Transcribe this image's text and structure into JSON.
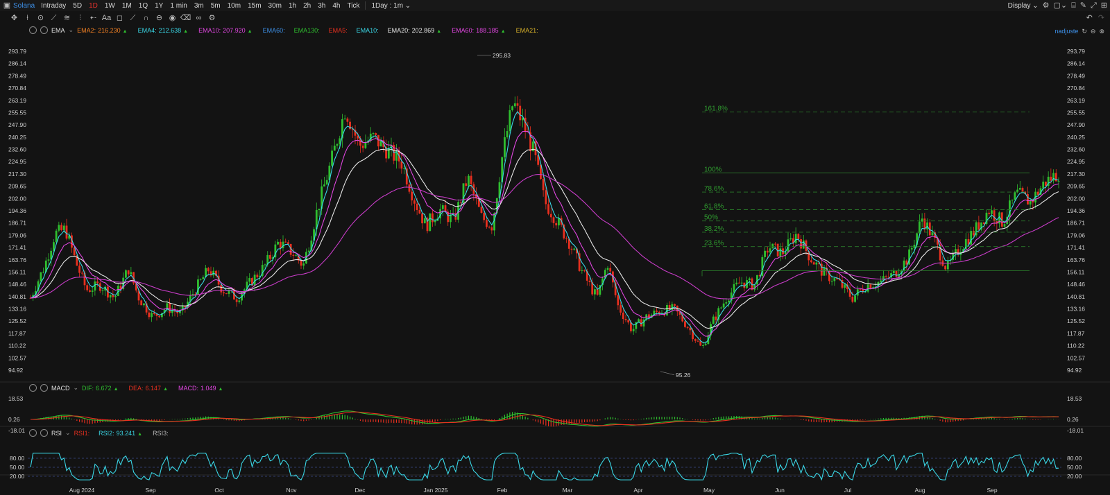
{
  "topbar": {
    "symbol": "Solana",
    "intervals": [
      "Intraday",
      "5D",
      "1D",
      "1W",
      "1M",
      "1Q",
      "1Y",
      "1 min",
      "3m",
      "5m",
      "10m",
      "15m",
      "30m",
      "1h",
      "2h",
      "3h",
      "4h",
      "Tick"
    ],
    "active_interval": "1D",
    "range_select": "1Day : 1m",
    "display_label": "Display",
    "adjust_label": "nadjuste"
  },
  "colors": {
    "up": "#2fbf2f",
    "down": "#e8301f",
    "accent": "#e6322d",
    "symbol": "#3d8fe6"
  },
  "main_legend": {
    "indicator": "EMA",
    "items": [
      {
        "label": "EMA2:",
        "value": "216.230",
        "color": "#f07f23",
        "arrow": "▲"
      },
      {
        "label": "EMA4:",
        "value": "212.638",
        "color": "#3ad7e6",
        "arrow": "▲"
      },
      {
        "label": "EMA10:",
        "value": "207.920",
        "color": "#e046e0",
        "arrow": "▲"
      },
      {
        "label": "EMA60:",
        "value": "",
        "color": "#3d8fe6",
        "arrow": ""
      },
      {
        "label": "EMA130:",
        "value": "",
        "color": "#2fbf2f",
        "arrow": ""
      },
      {
        "label": "EMA5:",
        "value": "",
        "color": "#e8301f",
        "arrow": ""
      },
      {
        "label": "EMA10:",
        "value": "",
        "color": "#3ad7e6",
        "arrow": ""
      },
      {
        "label": "EMA20:",
        "value": "202.869",
        "color": "#e6e6e6",
        "arrow": "▲"
      },
      {
        "label": "EMA60:",
        "value": "188.185",
        "color": "#e046e0",
        "arrow": "▲"
      },
      {
        "label": "EMA21:",
        "value": "",
        "color": "#d6b02a",
        "arrow": ""
      }
    ]
  },
  "macd_legend": {
    "indicator": "MACD",
    "items": [
      {
        "label": "DIF:",
        "value": "6.672",
        "color": "#2fbf2f",
        "arrow": "▲"
      },
      {
        "label": "DEA:",
        "value": "6.147",
        "color": "#e8301f",
        "arrow": "▲"
      },
      {
        "label": "MACD:",
        "value": "1.049",
        "color": "#e046e0",
        "arrow": "▲"
      }
    ]
  },
  "rsi_legend": {
    "indicator": "RSI",
    "items": [
      {
        "label": "RSI1:",
        "value": "",
        "color": "#e8301f",
        "arrow": ""
      },
      {
        "label": "RSI2:",
        "value": "93.241",
        "color": "#3ad7e6",
        "arrow": "▲"
      },
      {
        "label": "RSI3:",
        "value": "",
        "color": "#bdbdbd",
        "arrow": ""
      }
    ]
  },
  "chart_data": {
    "type": "candlestick",
    "y_ticks": [
      "293.79",
      "286.14",
      "278.49",
      "270.84",
      "263.19",
      "255.55",
      "247.90",
      "240.25",
      "232.60",
      "224.95",
      "217.30",
      "209.65",
      "202.00",
      "194.36",
      "186.71",
      "179.06",
      "171.41",
      "163.76",
      "156.11",
      "148.46",
      "140.81",
      "133.16",
      "125.52",
      "117.87",
      "110.22",
      "102.57",
      "94.92"
    ],
    "ylim": [
      94.92,
      293.79
    ],
    "high_label": "295.83",
    "low_label": "95.26",
    "x_ticks": [
      "Aug 2024",
      "Sep",
      "Oct",
      "Nov",
      "Dec",
      "Jan 2025",
      "Feb",
      "Mar",
      "Apr",
      "May",
      "Jun",
      "Jul",
      "Aug",
      "Sep"
    ],
    "price_path": [
      [
        0,
        140
      ],
      [
        4,
        160
      ],
      [
        7,
        180
      ],
      [
        10,
        183
      ],
      [
        13,
        162
      ],
      [
        16,
        145
      ],
      [
        20,
        148
      ],
      [
        24,
        140
      ],
      [
        28,
        158
      ],
      [
        31,
        140
      ],
      [
        35,
        128
      ],
      [
        39,
        134
      ],
      [
        43,
        130
      ],
      [
        47,
        145
      ],
      [
        51,
        158
      ],
      [
        55,
        145
      ],
      [
        59,
        140
      ],
      [
        63,
        150
      ],
      [
        67,
        160
      ],
      [
        71,
        175
      ],
      [
        75,
        168
      ],
      [
        78,
        160
      ],
      [
        82,
        195
      ],
      [
        86,
        225
      ],
      [
        90,
        258
      ],
      [
        94,
        235
      ],
      [
        98,
        240
      ],
      [
        102,
        232
      ],
      [
        106,
        225
      ],
      [
        110,
        200
      ],
      [
        113,
        185
      ],
      [
        117,
        195
      ],
      [
        121,
        188
      ],
      [
        125,
        215
      ],
      [
        129,
        190
      ],
      [
        132,
        185
      ],
      [
        135,
        230
      ],
      [
        138,
        262
      ],
      [
        141,
        248
      ],
      [
        144,
        230
      ],
      [
        147,
        200
      ],
      [
        150,
        190
      ],
      [
        154,
        175
      ],
      [
        158,
        155
      ],
      [
        162,
        140
      ],
      [
        165,
        162
      ],
      [
        168,
        135
      ],
      [
        172,
        120
      ],
      [
        176,
        128
      ],
      [
        180,
        132
      ],
      [
        184,
        133
      ],
      [
        188,
        122
      ],
      [
        192,
        108
      ],
      [
        195,
        125
      ],
      [
        199,
        140
      ],
      [
        203,
        150
      ],
      [
        207,
        148
      ],
      [
        211,
        172
      ],
      [
        215,
        168
      ],
      [
        219,
        180
      ],
      [
        223,
        165
      ],
      [
        227,
        155
      ],
      [
        231,
        150
      ],
      [
        235,
        140
      ],
      [
        239,
        148
      ],
      [
        243,
        150
      ],
      [
        247,
        155
      ],
      [
        251,
        165
      ],
      [
        255,
        190
      ],
      [
        258,
        178
      ],
      [
        262,
        158
      ],
      [
        266,
        172
      ],
      [
        270,
        182
      ],
      [
        274,
        195
      ],
      [
        278,
        187
      ],
      [
        282,
        205
      ],
      [
        286,
        200
      ],
      [
        290,
        212
      ],
      [
        294,
        218
      ]
    ],
    "fibonacci": [
      {
        "label": "161.8%",
        "value": 256
      },
      {
        "label": "100%",
        "value": 218
      },
      {
        "label": "78.6%",
        "value": 206
      },
      {
        "label": "61.8%",
        "value": 195
      },
      {
        "label": "50%",
        "value": 188
      },
      {
        "label": "38.2%",
        "value": 181
      },
      {
        "label": "23.6%",
        "value": 172
      }
    ],
    "fib_base": 157,
    "macd_ticks": [
      "18.53",
      "0.26",
      "-18.01"
    ],
    "rsi_ticks": [
      "80.00",
      "50.00",
      "20.00"
    ]
  }
}
